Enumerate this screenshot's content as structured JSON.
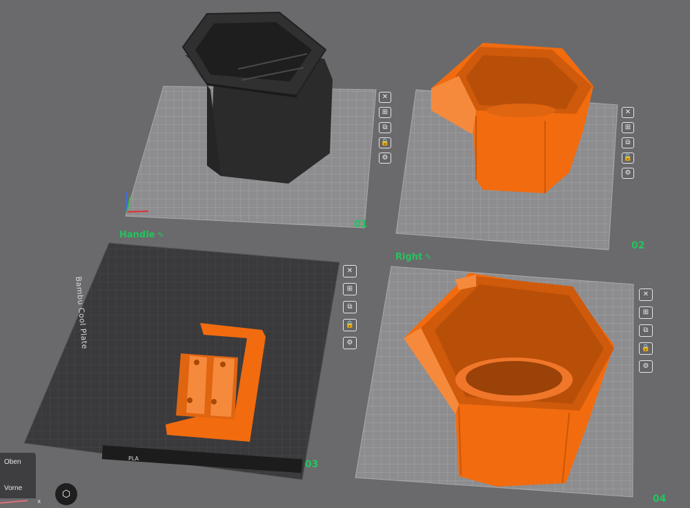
{
  "plates": [
    {
      "number": "01",
      "name": ""
    },
    {
      "number": "02",
      "name": ""
    },
    {
      "number": "03",
      "name": "Handle",
      "plate_text": "Bambu Cool Plate",
      "filament_tag": "PLA"
    },
    {
      "number": "04",
      "name": "Right"
    }
  ],
  "plate_tools": [
    "close-icon",
    "arrange-icon",
    "orient-icon",
    "lock-icon",
    "settings-icon"
  ],
  "viewcube": {
    "top": "Oben",
    "front": "Vorne",
    "axis": "x"
  },
  "colors": {
    "background": "#6a6a6c",
    "accent_label": "#22c55e",
    "model_orange": "#f26b0f",
    "model_black": "#2a2a2a"
  }
}
